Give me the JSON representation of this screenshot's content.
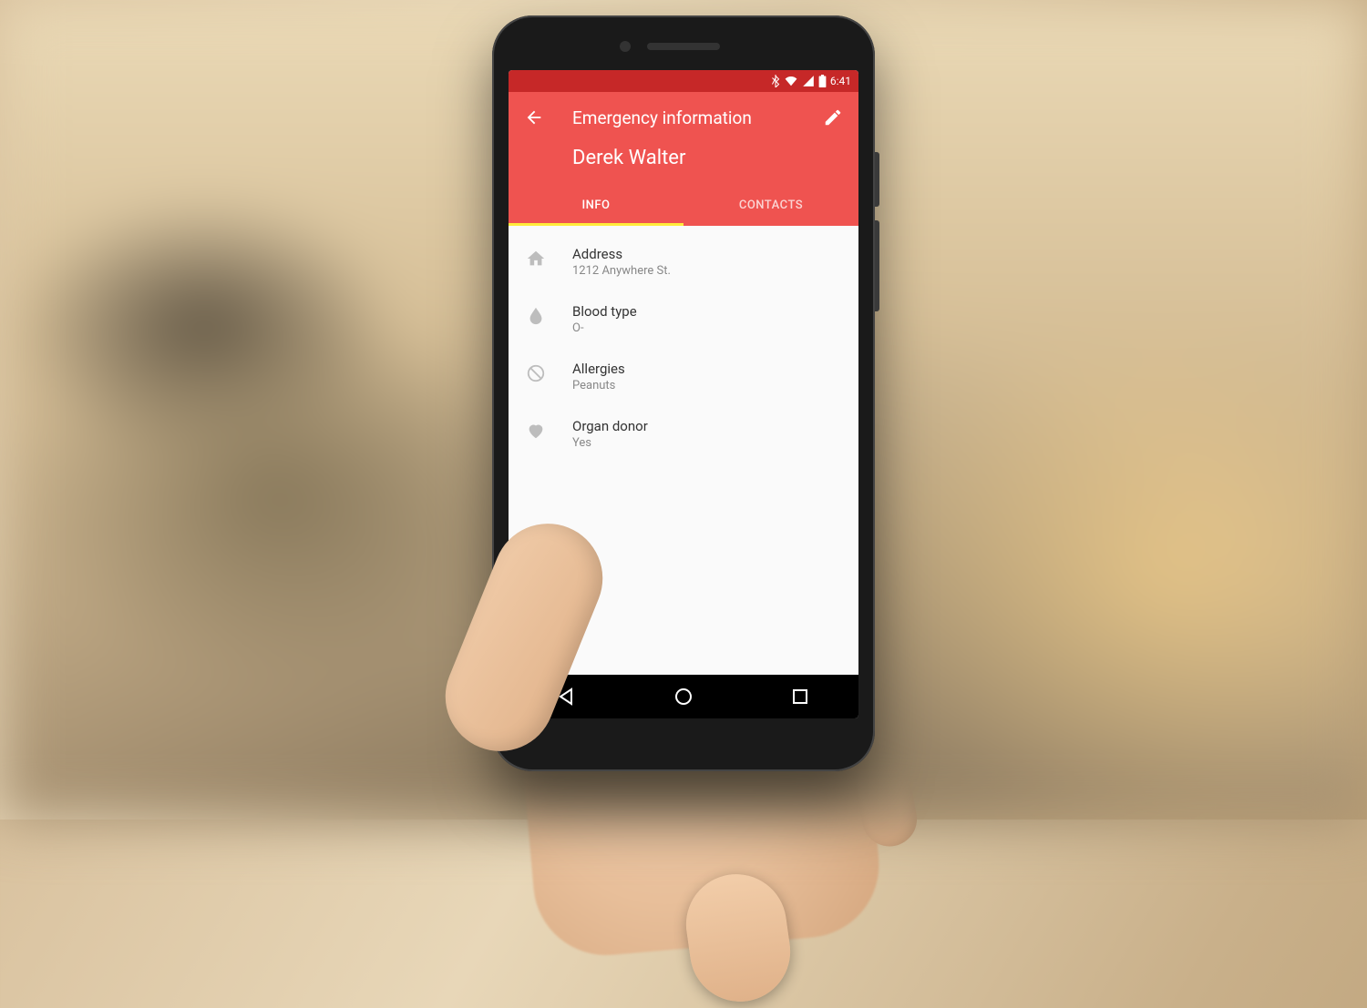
{
  "statusbar": {
    "time": "6:41"
  },
  "appbar": {
    "title": "Emergency information",
    "name": "Derek Walter"
  },
  "tabs": {
    "info": "INFO",
    "contacts": "CONTACTS"
  },
  "info": [
    {
      "icon": "home-icon",
      "label": "Address",
      "value": "1212 Anywhere St."
    },
    {
      "icon": "drop-icon",
      "label": "Blood type",
      "value": "O-"
    },
    {
      "icon": "block-icon",
      "label": "Allergies",
      "value": "Peanuts"
    },
    {
      "icon": "heart-icon",
      "label": "Organ donor",
      "value": "Yes"
    }
  ]
}
